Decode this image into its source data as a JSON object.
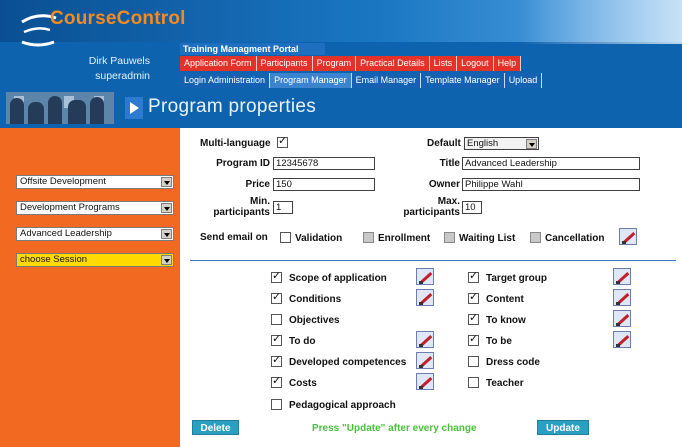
{
  "header": {
    "app_name": "CourseControl",
    "user_name": "Dirk Pauwels",
    "user_role": "superadmin",
    "portal_title": "Training Managment Portal",
    "page_title": "Program properties",
    "nav_primary": [
      "Application Form",
      "Participants",
      "Program",
      "Practical Details",
      "Lists",
      "Logout",
      "Help"
    ],
    "nav_secondary": [
      "Login Administration",
      "Program Manager",
      "Email Manager",
      "Template Manager",
      "Upload"
    ],
    "active_secondary": "Program Manager"
  },
  "sidebar": {
    "selects": [
      "Offsite Development",
      "Development Programs",
      "Advanced Leadership",
      "choose Session"
    ]
  },
  "form": {
    "multilanguage_label": "Multi-language",
    "multilanguage_checked": true,
    "default_label": "Default",
    "default_value": "English",
    "program_id_label": "Program ID",
    "program_id_value": "12345678",
    "title_label": "Title",
    "title_value": "Advanced Leadership",
    "price_label": "Price",
    "price_value": "150",
    "owner_label": "Owner",
    "owner_value": "Philippe Wahl",
    "min_label_1": "Min.",
    "min_label_2": "participants",
    "min_value": "1",
    "max_label_1": "Max.",
    "max_label_2": "participants",
    "max_value": "10",
    "send_email_label": "Send email on",
    "email_options": [
      {
        "label": "Validation",
        "checked": false
      },
      {
        "label": "Enrollment",
        "checked": false
      },
      {
        "label": "Waiting List",
        "checked": false
      },
      {
        "label": "Cancellation",
        "checked": false
      }
    ]
  },
  "sections": {
    "left": [
      {
        "label": "Scope of application",
        "checked": true,
        "edit": true
      },
      {
        "label": "Conditions",
        "checked": true,
        "edit": true
      },
      {
        "label": "Objectives",
        "checked": false,
        "edit": false
      },
      {
        "label": "To do",
        "checked": true,
        "edit": true
      },
      {
        "label": "Developed competences",
        "checked": true,
        "edit": true
      },
      {
        "label": "Costs",
        "checked": true,
        "edit": true
      },
      {
        "label": "Pedagogical approach",
        "checked": false,
        "edit": false
      }
    ],
    "right": [
      {
        "label": "Target group",
        "checked": true,
        "edit": true
      },
      {
        "label": "Content",
        "checked": true,
        "edit": true
      },
      {
        "label": "To know",
        "checked": true,
        "edit": true
      },
      {
        "label": "To be",
        "checked": true,
        "edit": true
      },
      {
        "label": "Dress code",
        "checked": false,
        "edit": false
      },
      {
        "label": "Teacher",
        "checked": false,
        "edit": false
      }
    ]
  },
  "actions": {
    "delete_label": "Delete",
    "update_label": "Update",
    "hint": "Press \"Update\" after every change"
  },
  "colors": {
    "brand_orange": "#f26a21",
    "header_blue": "#0d63ad",
    "nav_red": "#e2322a",
    "button_teal": "#2a9fc2",
    "hint_green": "#48c23a"
  }
}
